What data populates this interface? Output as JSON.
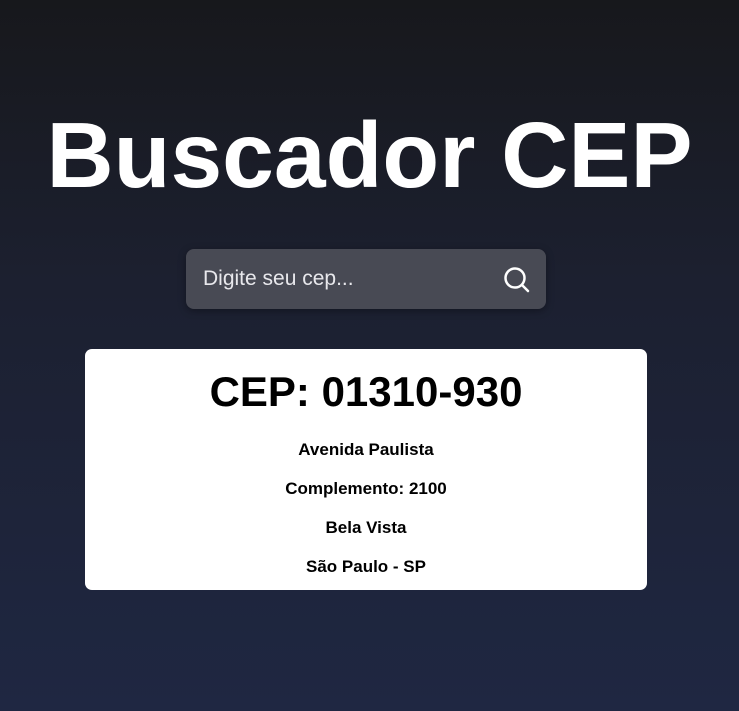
{
  "header": {
    "title": "Buscador CEP"
  },
  "search": {
    "placeholder": "Digite seu cep...",
    "value": "",
    "icon": "search-icon"
  },
  "result": {
    "cep": "CEP: 01310-930",
    "logradouro": "Avenida Paulista",
    "complemento": "Complemento: 2100",
    "bairro": "Bela Vista",
    "cidade_uf": "São Paulo - SP"
  }
}
